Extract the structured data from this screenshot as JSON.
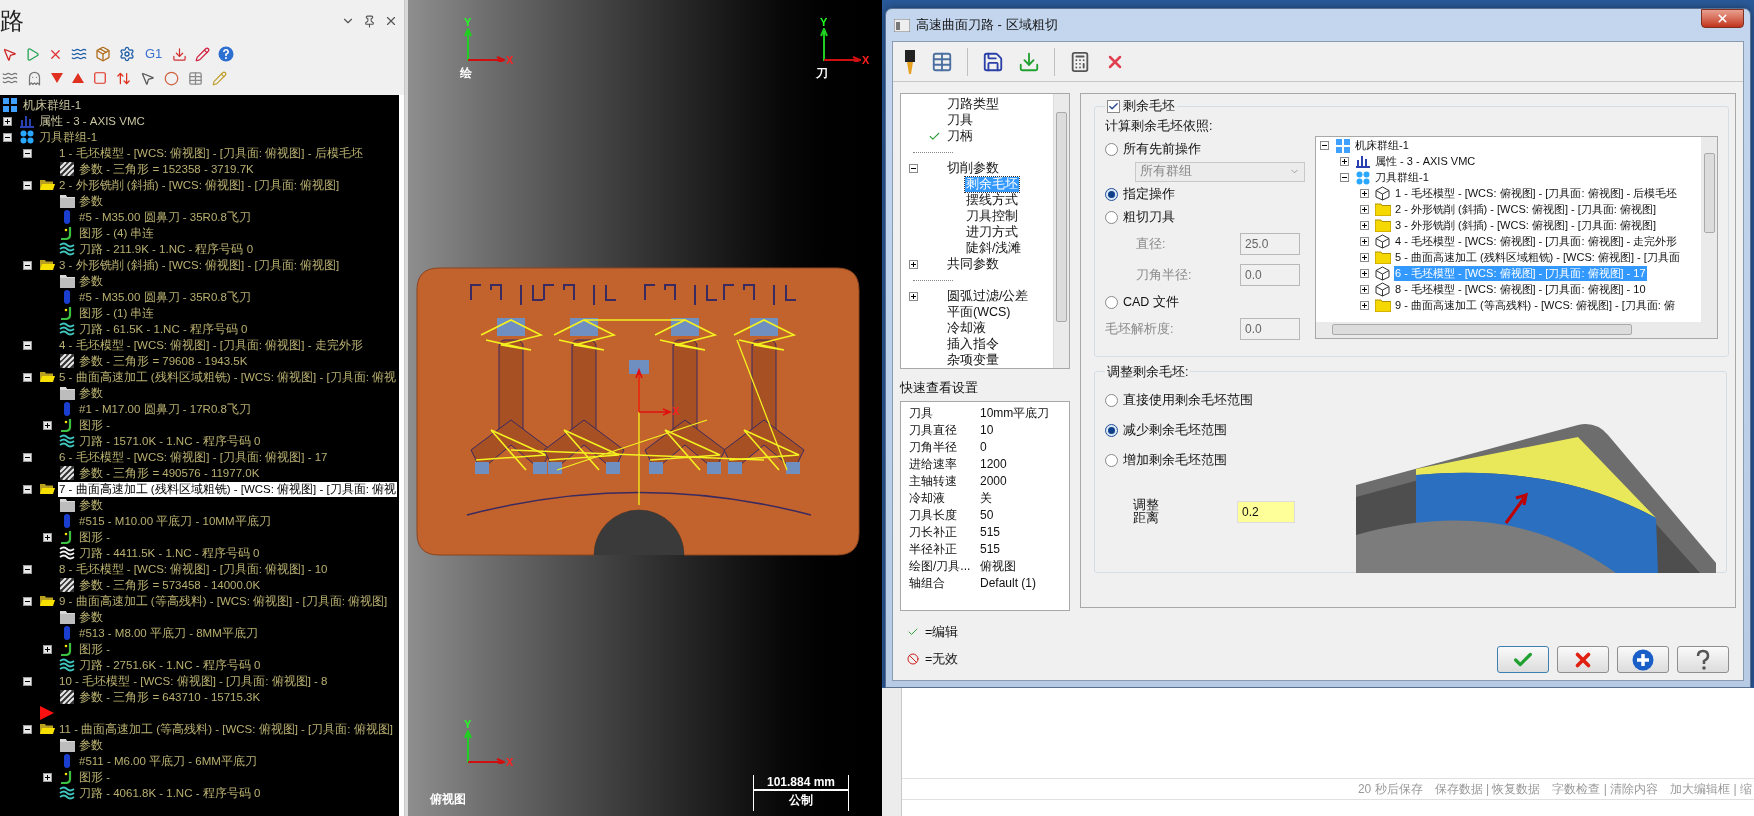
{
  "tool_panel": {
    "title": "路",
    "toolbar_text": "G1",
    "tree": [
      {
        "kind": "machine",
        "text": "机床群组-1",
        "children": [
          {
            "kind": "properties",
            "text": "属性 - 3 - AXIS VMC",
            "expanded": false
          },
          {
            "kind": "toolgroup",
            "text": "刀具群组-1",
            "expanded": true,
            "children": [
              {
                "kind": "stock",
                "text": "1 - 毛坯模型 - [WCS: 俯视图] - [刀具面: 俯视图] - 后模毛坯",
                "expanded": true,
                "selected": false,
                "children": [
                  {
                    "kind": "mesh",
                    "text": "参数 - 三角形 =  152358 - 3719.7K"
                  }
                ]
              },
              {
                "kind": "operation",
                "text": "2 - 外形铣削 (斜插) - [WCS: 俯视图] - [刀具面: 俯视图]",
                "expanded": true,
                "selected": false,
                "children": [
                  {
                    "kind": "params",
                    "text": "参数"
                  },
                  {
                    "kind": "tool",
                    "text": "#5 - M35.00 圆鼻刀 - 35R0.8飞刀"
                  },
                  {
                    "kind": "geometry",
                    "text": "图形 - (4) 串连"
                  },
                  {
                    "kind": "toolpath",
                    "text": "刀路 - 211.9K - 1.NC - 程序号码 0",
                    "dirty": false
                  }
                ]
              },
              {
                "kind": "operation",
                "text": "3 - 外形铣削 (斜插) - [WCS: 俯视图] - [刀具面: 俯视图]",
                "expanded": true,
                "selected": false,
                "children": [
                  {
                    "kind": "params",
                    "text": "参数"
                  },
                  {
                    "kind": "tool",
                    "text": "#5 - M35.00 圆鼻刀 - 35R0.8飞刀"
                  },
                  {
                    "kind": "geometry",
                    "text": "图形 - (1) 串连"
                  },
                  {
                    "kind": "toolpath",
                    "text": "刀路 - 61.5K - 1.NC - 程序号码 0",
                    "dirty": false
                  }
                ]
              },
              {
                "kind": "stock",
                "text": "4 - 毛坯模型 - [WCS: 俯视图] - [刀具面: 俯视图] - 走完外形",
                "expanded": true,
                "selected": false,
                "children": [
                  {
                    "kind": "mesh",
                    "text": "参数 - 三角形 =  79608 - 1943.5K"
                  }
                ]
              },
              {
                "kind": "operation",
                "text": "5 - 曲面高速加工 (残料区域粗铣) - [WCS: 俯视图] - [刀具面: 俯视",
                "expanded": true,
                "selected": false,
                "children": [
                  {
                    "kind": "params",
                    "text": "参数"
                  },
                  {
                    "kind": "tool",
                    "text": "#1 - M17.00 圆鼻刀 - 17R0.8飞刀"
                  },
                  {
                    "kind": "geometry",
                    "text": "图形 -",
                    "expanded": false
                  },
                  {
                    "kind": "toolpath",
                    "text": "刀路 - 1571.0K - 1.NC - 程序号码 0",
                    "dirty": false
                  }
                ]
              },
              {
                "kind": "stock",
                "text": "6 - 毛坯模型 - [WCS: 俯视图] - [刀具面: 俯视图] - 17",
                "expanded": true,
                "selected": false,
                "children": [
                  {
                    "kind": "mesh",
                    "text": "参数 - 三角形 =  490576 - 11977.0K"
                  }
                ]
              },
              {
                "kind": "operation",
                "text": "7 - 曲面高速加工 (残料区域粗铣) - [WCS: 俯视图] - [刀具面: 俯视",
                "expanded": true,
                "selected": true,
                "children": [
                  {
                    "kind": "params",
                    "text": "参数"
                  },
                  {
                    "kind": "tool",
                    "text": "#515 - M10.00 平底刀 - 10MM平底刀"
                  },
                  {
                    "kind": "geometry",
                    "text": "图形 -",
                    "expanded": false
                  },
                  {
                    "kind": "toolpath",
                    "text": "刀路 - 4411.5K - 1.NC - 程序号码 0",
                    "dirty": true
                  }
                ]
              },
              {
                "kind": "stock",
                "text": "8 - 毛坯模型 - [WCS: 俯视图] - [刀具面: 俯视图] - 10",
                "expanded": true,
                "selected": false,
                "children": [
                  {
                    "kind": "mesh",
                    "text": "参数 - 三角形 =  573458 - 14000.0K"
                  }
                ]
              },
              {
                "kind": "operation",
                "text": "9 - 曲面高速加工 (等高残料) - [WCS: 俯视图] - [刀具面: 俯视图]",
                "expanded": true,
                "selected": false,
                "children": [
                  {
                    "kind": "params",
                    "text": "参数"
                  },
                  {
                    "kind": "tool",
                    "text": "#513 - M8.00 平底刀 - 8MM平底刀"
                  },
                  {
                    "kind": "geometry",
                    "text": "图形 -",
                    "expanded": false
                  },
                  {
                    "kind": "toolpath",
                    "text": "刀路 - 2751.6K - 1.NC - 程序号码 0",
                    "dirty": false
                  }
                ]
              },
              {
                "kind": "stock",
                "text": "10 - 毛坯模型 - [WCS: 俯视图] - [刀具面: 俯视图] - 8",
                "expanded": true,
                "selected": false,
                "children": [
                  {
                    "kind": "mesh",
                    "text": "参数 - 三角形 =  643710 - 15715.3K"
                  }
                ]
              },
              {
                "kind": "insert-marker"
              },
              {
                "kind": "operation",
                "text": "11 - 曲面高速加工 (等高残料) - [WCS: 俯视图] - [刀具面: 俯视图]",
                "expanded": true,
                "selected": false,
                "children": [
                  {
                    "kind": "params",
                    "text": "参数"
                  },
                  {
                    "kind": "tool",
                    "text": "#511 - M6.00 平底刀 - 6MM平底刀"
                  },
                  {
                    "kind": "geometry",
                    "text": "图形 -",
                    "expanded": false
                  },
                  {
                    "kind": "toolpath",
                    "text": "刀路 - 4061.8K - 1.NC - 程序号码 0",
                    "dirty": false
                  }
                ]
              }
            ]
          }
        ]
      }
    ]
  },
  "viewport": {
    "axes": [
      {
        "y": "Y",
        "x": "X",
        "view": "绘"
      },
      {
        "y": "Y",
        "x": "X",
        "view": "刀"
      },
      {
        "y": "Y",
        "x": "X"
      }
    ],
    "origin_x": "X",
    "view_name": "俯视图",
    "scale": "101.884 mm",
    "units": "公制"
  },
  "dialog": {
    "title": "高速曲面刀路 - 区域粗切",
    "nav": [
      {
        "text": "刀路类型",
        "edited": false,
        "selected": false
      },
      {
        "text": "刀具",
        "edited": false,
        "selected": false
      },
      {
        "text": "刀柄",
        "edited": true,
        "selected": false
      },
      {
        "kind": "spacer"
      },
      {
        "text": "切削参数",
        "edited": false,
        "selected": false,
        "expanded": true,
        "children": [
          {
            "text": "剩余毛坯",
            "edited": false,
            "selected": true
          },
          {
            "text": "摆线方式",
            "edited": false,
            "selected": false
          },
          {
            "text": "刀具控制",
            "edited": false,
            "selected": false
          },
          {
            "text": "进刀方式",
            "edited": false,
            "selected": false
          },
          {
            "text": "陡斜/浅滩",
            "edited": false,
            "selected": false
          }
        ]
      },
      {
        "text": "共同参数",
        "edited": false,
        "selected": false,
        "expanded": false
      },
      {
        "kind": "spacer"
      },
      {
        "text": "圆弧过滤/公差",
        "edited": false,
        "selected": false,
        "expanded": false
      },
      {
        "text": "平面(WCS)",
        "edited": false,
        "selected": false
      },
      {
        "text": "冷却液",
        "edited": false,
        "selected": false
      },
      {
        "text": "插入指令",
        "edited": false,
        "selected": false
      },
      {
        "text": "杂项变量",
        "edited": false,
        "selected": false
      }
    ],
    "quick_view": {
      "title": "快速查看设置",
      "rows": [
        {
          "label": "刀具",
          "value": "10mm平底刀"
        },
        {
          "label": "刀具直径",
          "value": "10"
        },
        {
          "label": "刀角半径",
          "value": "0"
        },
        {
          "label": "进给速率",
          "value": "1200"
        },
        {
          "label": "主轴转速",
          "value": "2000"
        },
        {
          "label": "冷却液",
          "value": "关"
        },
        {
          "label": "刀具长度",
          "value": "50"
        },
        {
          "label": "刀长补正",
          "value": "515"
        },
        {
          "label": "半径补正",
          "value": "515"
        },
        {
          "label": "绘图/刀具...",
          "value": "俯视图"
        },
        {
          "label": "轴组合",
          "value": "Default (1)"
        }
      ]
    },
    "remaining_stock": {
      "label": "剩余毛坯",
      "checked": true,
      "basis_label": "计算剩余毛坯依照:",
      "options": [
        {
          "kind": "radio",
          "label": "所有先前操作",
          "selected": false
        },
        {
          "kind": "dropdown",
          "value": "所有群组",
          "disabled": true
        },
        {
          "kind": "radio",
          "label": "指定操作",
          "selected": true
        },
        {
          "kind": "radio",
          "label": "粗切刀具",
          "selected": false
        },
        {
          "kind": "sub-field",
          "label": "直径:",
          "value": "25.0",
          "disabled": true
        },
        {
          "kind": "sub-field",
          "label": "刀角半径:",
          "value": "0.0",
          "disabled": true
        },
        {
          "kind": "radio",
          "label": "CAD 文件",
          "selected": false
        },
        {
          "kind": "field",
          "label": "毛坯解析度:",
          "value": "0.0",
          "disabled": true
        }
      ],
      "operations": [
        {
          "kind": "machine",
          "text": "机床群组-1",
          "expanded": true,
          "children": [
            {
              "kind": "properties",
              "text": "属性 - 3 - AXIS VMC",
              "expanded": false
            },
            {
              "kind": "toolgroup",
              "text": "刀具群组-1",
              "expanded": true,
              "children": [
                {
                  "kind": "stock",
                  "text": "1 - 毛坯模型 - [WCS: 俯视图] - [刀具面: 俯视图] - 后模毛坯",
                  "expanded": false,
                  "selected": false
                },
                {
                  "kind": "operation",
                  "text": "2 - 外形铣削 (斜插) - [WCS: 俯视图] - [刀具面: 俯视图]",
                  "expanded": false,
                  "selected": false
                },
                {
                  "kind": "operation",
                  "text": "3 - 外形铣削 (斜插) - [WCS: 俯视图] - [刀具面: 俯视图]",
                  "expanded": false,
                  "selected": false
                },
                {
                  "kind": "stock",
                  "text": "4 - 毛坯模型 - [WCS: 俯视图] - [刀具面: 俯视图] - 走完外形",
                  "expanded": false,
                  "selected": false
                },
                {
                  "kind": "operation",
                  "text": "5 - 曲面高速加工 (残料区域粗铣) - [WCS: 俯视图] - [刀具面",
                  "expanded": false,
                  "selected": false
                },
                {
                  "kind": "stock",
                  "text": "6 - 毛坯模型 - [WCS: 俯视图] - [刀具面: 俯视图] - 17",
                  "expanded": false,
                  "selected": true
                },
                {
                  "kind": "stock",
                  "text": "8 - 毛坯模型 - [WCS: 俯视图] - [刀具面: 俯视图] - 10",
                  "expanded": false,
                  "selected": false
                },
                {
                  "kind": "operation",
                  "text": "9 - 曲面高速加工 (等高残料) - [WCS: 俯视图] - [刀具面: 俯",
                  "expanded": false,
                  "selected": false
                }
              ]
            }
          ]
        }
      ]
    },
    "adjust": {
      "title": "调整剩余毛坯:",
      "options": [
        {
          "label": "直接使用剩余毛坯范围",
          "selected": false
        },
        {
          "label": "减少剩余毛坯范围",
          "selected": true
        },
        {
          "label": "增加剩余毛坯范围",
          "selected": false
        }
      ],
      "distance_label": "调整距离",
      "distance": "0.2"
    },
    "legend": [
      {
        "kind": "edited",
        "text": "=编辑"
      },
      {
        "kind": "invalid",
        "text": "=无效"
      }
    ],
    "buttons": [
      {
        "kind": "ok"
      },
      {
        "kind": "cancel"
      },
      {
        "kind": "add"
      },
      {
        "kind": "help"
      }
    ]
  },
  "background_app": {
    "status_items": [
      "20 秒后保存",
      "保存数据 | 恢复数据",
      "字数检查 | 清除内容",
      "加大编辑框 | 缩"
    ]
  }
}
